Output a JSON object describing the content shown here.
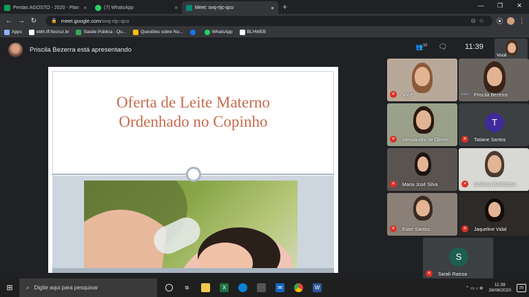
{
  "browser": {
    "tabs": [
      {
        "title": "Perdas AGOSTO - 2020 - Planilha",
        "color": "#0f9d58",
        "close": "×"
      },
      {
        "title": "(7) WhatsApp",
        "color": "#25d366",
        "close": "×"
      },
      {
        "title": "Meet: ovq-rtjc-qco",
        "color": "#00897b",
        "close": "●"
      }
    ],
    "new_tab": "+",
    "window_controls": [
      "—",
      "❐",
      "✕"
    ],
    "url_host": "meet.google.com",
    "url_path": "/ovq-rtjc-qco",
    "bookmarks": [
      {
        "label": "Apps",
        "color": "#8ab4f8"
      },
      {
        "label": "eblh.iff.fiocruz.br",
        "color": "#ffffff"
      },
      {
        "label": "Saúde Pública - Qu...",
        "color": "#34a853"
      },
      {
        "label": "Questões sobre Nu...",
        "color": "#fbbc04"
      },
      {
        "label": "",
        "color": "#1877f2"
      },
      {
        "label": "WhatsApp",
        "color": "#25d366"
      },
      {
        "label": "BLHWEB",
        "color": "#ffffff"
      }
    ]
  },
  "meet": {
    "presenter_text": "Priscila Bezerra está apresentando",
    "people_count": "10",
    "clock": "11:39",
    "self_label": "Você",
    "slide_title_line1": "Oferta de Leite Materno",
    "slide_title_line2": "Ordenhado no Copinho",
    "participants": [
      {
        "name": "Você",
        "muted": true,
        "type": "video"
      },
      {
        "name": "Priscila Bezerra",
        "muted": false,
        "type": "video"
      },
      {
        "name": "Alessandra de Oliveir...",
        "muted": true,
        "type": "video"
      },
      {
        "name": "Tatiane Santos",
        "muted": true,
        "type": "initial",
        "initial": "T",
        "color": "#3f2a9a"
      },
      {
        "name": "Maria José Silva",
        "muted": true,
        "type": "video"
      },
      {
        "name": "SUENIA BARBOSA",
        "muted": true,
        "type": "video"
      },
      {
        "name": "Ester Santos",
        "muted": true,
        "type": "video"
      },
      {
        "name": "Jaqueline Vidal",
        "muted": true,
        "type": "video"
      },
      {
        "name": "Sarah Raissa",
        "muted": true,
        "type": "initial",
        "initial": "S",
        "color": "#1e5e4e"
      }
    ]
  },
  "taskbar": {
    "search_placeholder": "Digite aqui para pesquisar",
    "time": "11:39",
    "date": "28/08/2020",
    "notifications": "20"
  }
}
